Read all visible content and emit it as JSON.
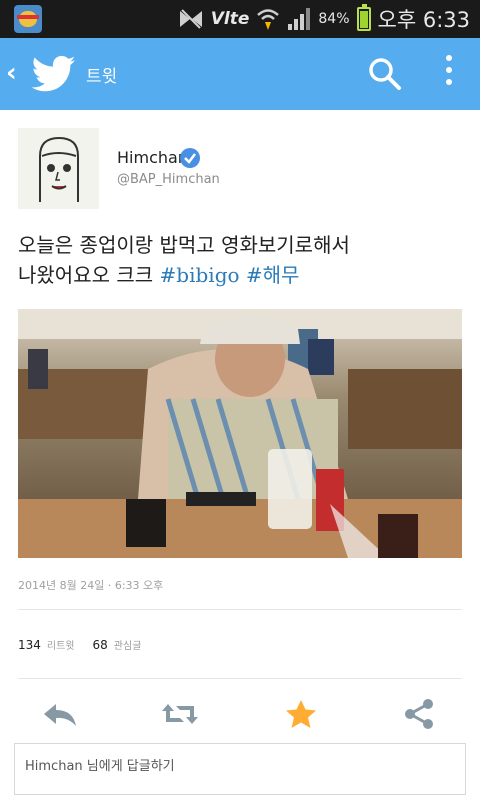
{
  "status_bar": {
    "app_icon": "game-app-icon",
    "network": "VoLTE",
    "network_label": "Vlte",
    "battery_percent": "84%",
    "battery_level": 0.84,
    "time": "오후 6:33"
  },
  "top_bar": {
    "background_color": "#55acee",
    "back_icon": "chevron-left-icon",
    "logo_icon": "twitter-bird-icon",
    "title": "트윗",
    "search_icon": "search-icon",
    "menu_icon": "overflow-menu-icon"
  },
  "tweet": {
    "author_name": "Himchan",
    "verified": true,
    "author_handle": "@BAP_Himchan",
    "text_line1": "오늘은 종업이랑 밥먹고 영화보기로해서",
    "text_line2": "나왔어요오  크크",
    "hashtags": [
      "#bibigo",
      "#해무"
    ],
    "hashtag_color": "#2b7bb9",
    "timestamp": "2014년 8월 24일  ·  6:33 오후",
    "retweet_count": "134",
    "retweet_label": "리트윗",
    "favorite_count": "68",
    "favorite_label": "관심글"
  },
  "actions": {
    "reply_icon": "reply-icon",
    "retweet_icon": "retweet-icon",
    "favorite_icon": "star-icon",
    "favorite_color": "#ffac33",
    "share_icon": "share-icon"
  },
  "reply": {
    "placeholder": "Himchan 님에게 답글하기"
  }
}
